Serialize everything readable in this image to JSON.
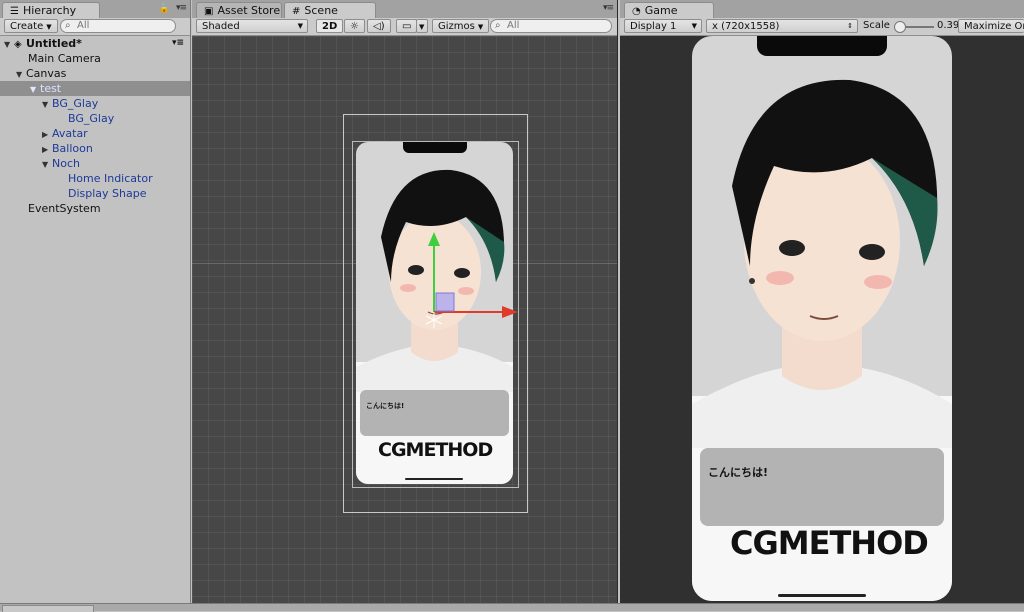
{
  "hierarchy": {
    "tab_label": "Hierarchy",
    "create_label": "Create",
    "search_placeholder": "All",
    "scene_name": "Untitled*",
    "items": [
      {
        "label": "Main Camera"
      },
      {
        "label": "Canvas"
      },
      {
        "label": "test"
      },
      {
        "label": "BG_Glay"
      },
      {
        "label": "BG_Glay"
      },
      {
        "label": "Avatar"
      },
      {
        "label": "Balloon"
      },
      {
        "label": "Noch"
      },
      {
        "label": "Home Indicator"
      },
      {
        "label": "Display Shape"
      },
      {
        "label": "EventSystem"
      }
    ]
  },
  "scene": {
    "tab_asset_store": "Asset Store",
    "tab_scene": "Scene",
    "shading_mode": "Shaded",
    "mode_2d": "2D",
    "gizmos_label": "Gizmos",
    "search_placeholder": "All"
  },
  "game": {
    "tab_label": "Game",
    "display": "Display 1",
    "resolution": "x (720x1558)",
    "scale_label": "Scale",
    "scale_value": "0.39",
    "maximize_label": "Maximize Or"
  },
  "content": {
    "greeting": "こんにちは!",
    "logo": "CGMETHOD"
  },
  "colors": {
    "selection": "#8f8f8f",
    "prefab_blue": "#1d3a9a",
    "gizmo_y": "#3ecf3e",
    "gizmo_x": "#e03a2a",
    "hair": "#101510",
    "hair_green": "#1f5a48"
  }
}
